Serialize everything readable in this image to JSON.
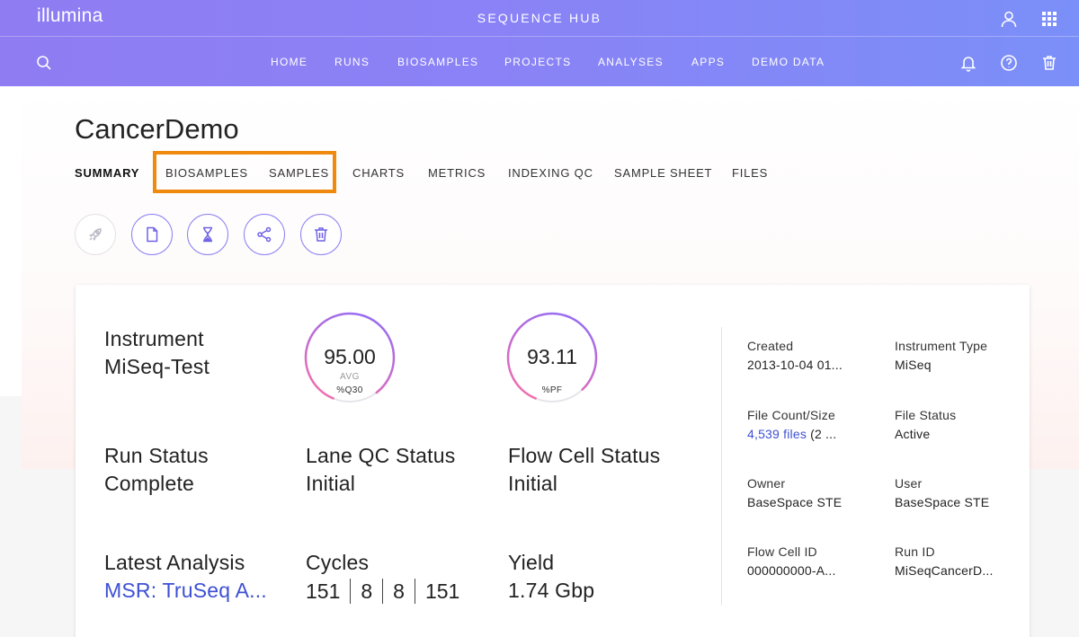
{
  "header": {
    "logo": "illumina",
    "app_title": "SEQUENCE HUB",
    "icons": [
      "search-icon",
      "user-icon",
      "apps-grid-icon",
      "bell-icon",
      "help-icon",
      "trash-icon"
    ],
    "nav": [
      "HOME",
      "RUNS",
      "BIOSAMPLES",
      "PROJECTS",
      "ANALYSES",
      "APPS",
      "DEMO DATA"
    ]
  },
  "run": {
    "title": "CancerDemo",
    "tabs": [
      "SUMMARY",
      "BIOSAMPLES",
      "SAMPLES",
      "CHARTS",
      "METRICS",
      "INDEXING QC",
      "SAMPLE SHEET",
      "FILES"
    ],
    "active_tab": "SUMMARY",
    "highlighted_tabs": [
      "BIOSAMPLES",
      "SAMPLES"
    ],
    "highlight_color": "#ef8a0f",
    "actions": [
      "launch-app-icon",
      "document-icon",
      "hourglass-icon",
      "share-icon",
      "trash-icon"
    ]
  },
  "summary": {
    "instrument": {
      "label": "Instrument",
      "value": "MiSeq-Test"
    },
    "q30": {
      "value": "95.00",
      "sub": "AVG",
      "name": "%Q30",
      "fraction": 0.95
    },
    "pf": {
      "value": "93.11",
      "name": "%PF",
      "fraction": 0.9311
    },
    "run_status": {
      "label": "Run Status",
      "value": "Complete"
    },
    "lane_qc": {
      "label": "Lane QC Status",
      "value": "Initial"
    },
    "flow_cell_status": {
      "label": "Flow Cell Status",
      "value": "Initial"
    },
    "latest_analysis": {
      "label": "Latest Analysis",
      "value": "MSR: TruSeq A..."
    },
    "cycles": {
      "label": "Cycles",
      "values": [
        "151",
        "8",
        "8",
        "151"
      ]
    },
    "yield": {
      "label": "Yield",
      "value": "1.74 Gbp"
    }
  },
  "details": {
    "created": {
      "label": "Created",
      "value": "2013-10-04 01..."
    },
    "instrument_type": {
      "label": "Instrument Type",
      "value": "MiSeq"
    },
    "file_count": {
      "label": "File Count/Size",
      "link": "4,539 files",
      "rest": " (2 ..."
    },
    "file_status": {
      "label": "File Status",
      "value": "Active"
    },
    "owner": {
      "label": "Owner",
      "value": "BaseSpace STE"
    },
    "user": {
      "label": "User",
      "value": "BaseSpace STE"
    },
    "flow_cell_id": {
      "label": "Flow Cell ID",
      "value": "000000000-A..."
    },
    "run_id": {
      "label": "Run ID",
      "value": "MiSeqCancerD..."
    }
  },
  "colors": {
    "accent": "#6f62e6",
    "link": "#3d50d4",
    "gauge_start": "#9a6cf0",
    "gauge_end": "#f06db0"
  }
}
